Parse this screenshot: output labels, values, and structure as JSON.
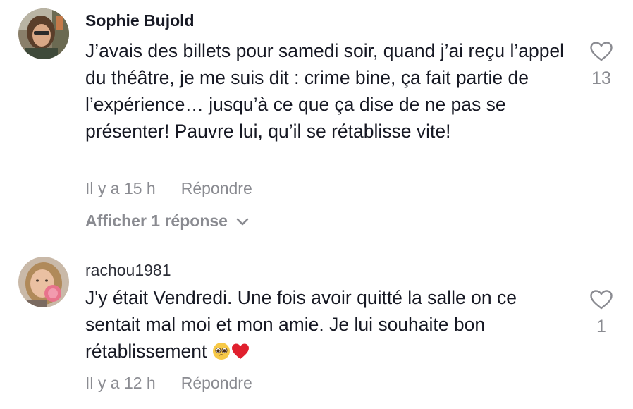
{
  "comments": [
    {
      "username": "Sophie Bujold",
      "text": "J’avais des billets pour samedi soir, quand j’ai reçu l’appel du théâtre, je me suis dit : crime bine, ça fait partie de l’expérience… jusqu’à ce que ça dise de ne pas se présenter! Pauvre lui, qu’il se rétablisse vite!",
      "time": "Il y a 15 h",
      "reply_label": "Répondre",
      "likes": "13",
      "view_replies": "Afficher 1 réponse",
      "like_icon": "heart-outline-icon"
    },
    {
      "username": "rachou1981",
      "text_before_emoji": "J'y était Vendredi. Une fois avoir quitté la salle on ce sentait mal moi et mon amie. Je lui souhaite bon rétablissement ",
      "emojis": [
        "pleading-face-emoji",
        "red-heart-emoji"
      ],
      "time": "Il y a 12 h",
      "reply_label": "Répondre",
      "likes": "1",
      "like_icon": "heart-outline-icon"
    }
  ],
  "colors": {
    "text": "#161823",
    "secondary": "#8a8b91",
    "icon": "#8a8b91",
    "heart_emoji": "#e0202e"
  }
}
